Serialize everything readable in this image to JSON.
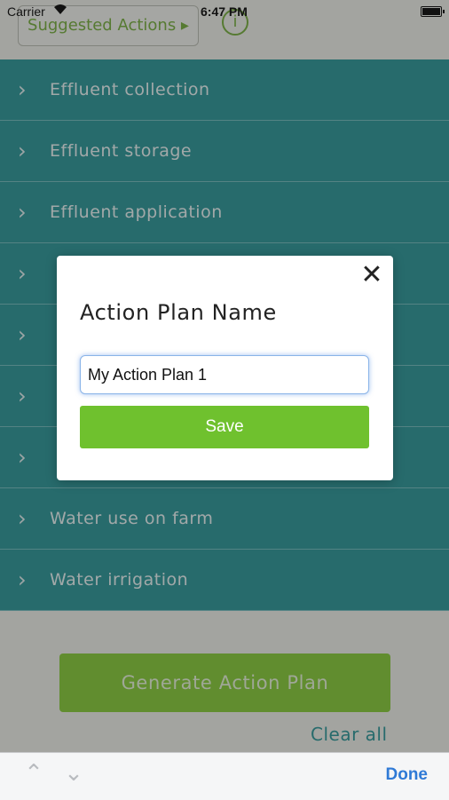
{
  "status_bar": {
    "carrier": "Carrier",
    "time": "6:47 PM"
  },
  "header": {
    "suggested_actions_label": "Suggested Actions ▸",
    "info_icon_label": "i"
  },
  "categories": [
    {
      "label": "Effluent collection"
    },
    {
      "label": "Effluent storage"
    },
    {
      "label": "Effluent application"
    },
    {
      "label": ""
    },
    {
      "label": ""
    },
    {
      "label": ""
    },
    {
      "label": ""
    },
    {
      "label": "Water use on farm"
    },
    {
      "label": "Water irrigation"
    }
  ],
  "generate_button": "Generate Action Plan",
  "clear_all": "Clear all",
  "modal": {
    "title": "Action Plan Name",
    "input_value": "My Action Plan 1",
    "save_label": "Save",
    "close_label": "✕"
  },
  "keyboard_toolbar": {
    "done_label": "Done"
  },
  "colors": {
    "teal": "#3a9ea0",
    "green": "#6fc12e",
    "accent_blue": "#2f7ad6"
  }
}
